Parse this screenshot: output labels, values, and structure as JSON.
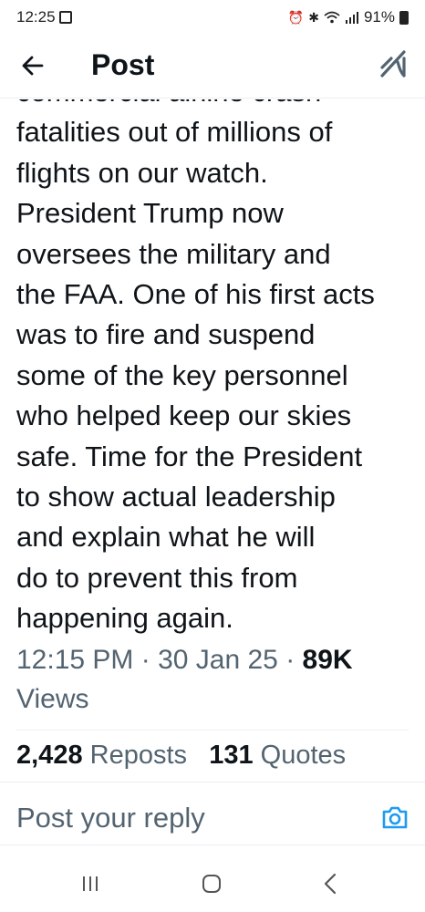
{
  "status_bar": {
    "time": "12:25",
    "battery": "91%"
  },
  "header": {
    "title": "Post"
  },
  "tweet": {
    "lines": [
      "commercial airline crash",
      "fatalities out of millions of",
      "flights on our watch.",
      "President Trump now",
      "oversees the military and",
      "the FAA. One of his first acts",
      "was to fire and suspend",
      "some of the key personnel",
      "who helped keep our skies",
      "safe. Time for the President",
      "to show actual leadership",
      "and explain what he will",
      "do to prevent this from",
      "happening again."
    ]
  },
  "meta": {
    "time": "12:15 PM",
    "sep1": " · ",
    "date": "30 Jan 25",
    "sep2": " · ",
    "views_count": "89K",
    "views_label": "Views"
  },
  "stats": {
    "reposts_count": "2,428",
    "reposts_label": "Reposts",
    "quotes_count": "131",
    "quotes_label": "Quotes"
  },
  "reply": {
    "placeholder": "Post your reply"
  },
  "colors": {
    "text": "#0f1419",
    "muted": "#536471",
    "accent": "#1d9bf0",
    "divider": "#eceff1"
  },
  "icons": {
    "back": "arrow-left-icon",
    "grok": "grok-icon",
    "camera": "camera-icon",
    "nav_recents": "recents-icon",
    "nav_home": "home-icon",
    "nav_back": "chevron-left-icon"
  }
}
